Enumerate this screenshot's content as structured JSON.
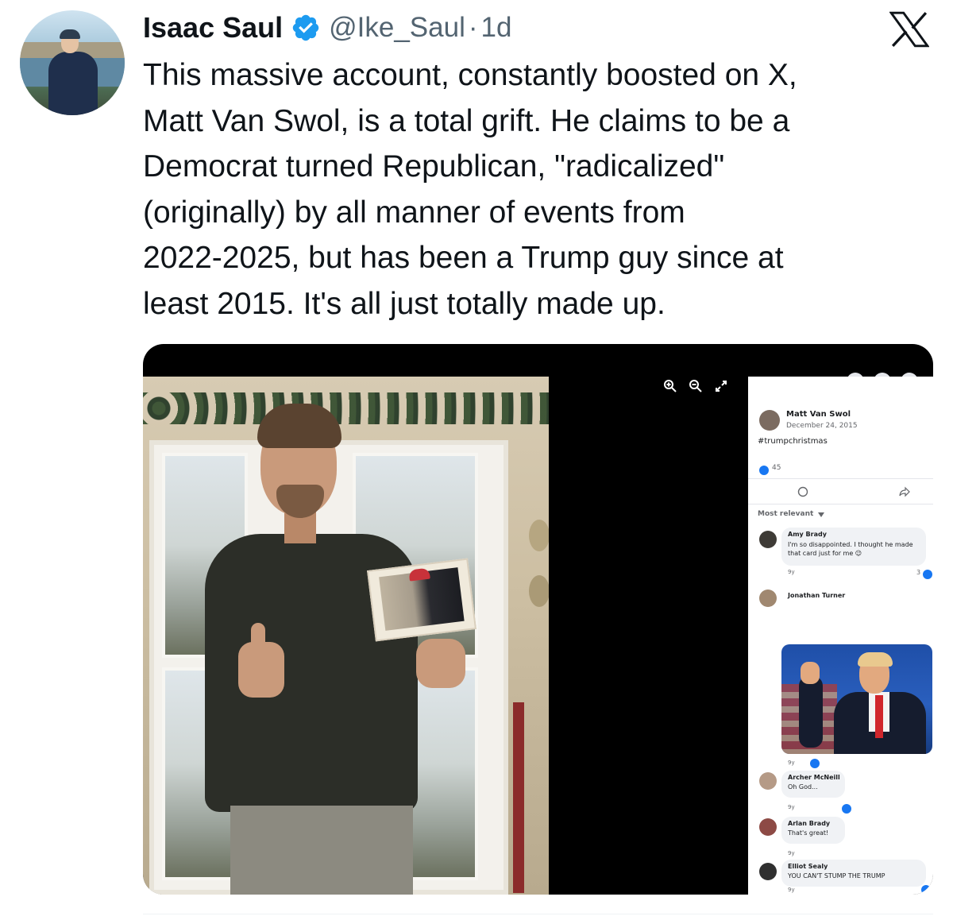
{
  "tweet": {
    "author_name": "Isaac Saul",
    "handle": "@Ike_Saul",
    "separator": "·",
    "time": "1d",
    "verified": true,
    "text": "This massive account, constantly boosted on X,\nMatt Van Swol, is a total grift. He claims to be a\nDemocrat turned Republican, \"radicalized\"\n(originally) by all manner of events from\n2022-2025, but has been a Trump guy since at\nleast 2015. It's all just totally made up.",
    "colors": {
      "verified_badge": "#1d9bf0",
      "handle": "#536471",
      "text": "#0f1419"
    },
    "icons": {
      "platform": "x-logo-icon",
      "verified": "verified-badge-icon"
    }
  },
  "embedded_post": {
    "author": "Matt Van Swol",
    "date": "December 24, 2015",
    "hashtag": "#trumpchristmas",
    "reaction_count": "45",
    "sort_label": "Most relevant",
    "comments": [
      {
        "name": "Amy Brady",
        "text": "I'm so disappointed. I thought he made that card just for me 😉",
        "age": "9y"
      },
      {
        "name": "Jonathan Turner",
        "text": "",
        "age": "9y"
      },
      {
        "name": "Archer McNeill",
        "text": "Oh God...",
        "age": "9y"
      },
      {
        "name": "Arlan Brady",
        "text": "That's great!",
        "age": "9y"
      },
      {
        "name": "Elliot Sealy",
        "text": "YOU CAN'T STUMP THE TRUMP",
        "age": "9y"
      }
    ],
    "side_count": "3"
  }
}
